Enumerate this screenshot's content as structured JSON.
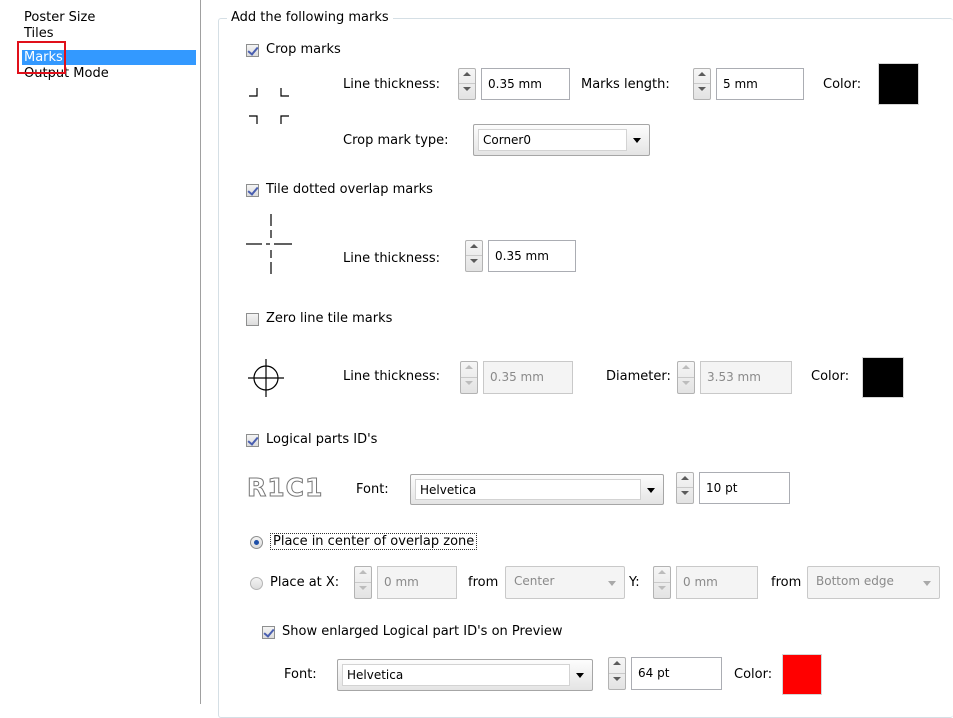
{
  "nav": {
    "items": [
      {
        "label": "Poster Size",
        "selected": false
      },
      {
        "label": "Tiles",
        "selected": false
      },
      {
        "label": "Marks",
        "selected": true
      },
      {
        "label": "Output Mode",
        "selected": false
      }
    ]
  },
  "group_title": "Add the following marks",
  "crop": {
    "label": "Crop marks",
    "checked": true,
    "thickness_label": "Line thickness:",
    "thickness_value": "0.35 mm",
    "length_label": "Marks length:",
    "length_value": "5 mm",
    "color_label": "Color:",
    "color": "#000000",
    "type_label": "Crop mark type:",
    "type_value": "Corner0"
  },
  "dotted": {
    "label": "Tile dotted overlap marks",
    "checked": true,
    "thickness_label": "Line thickness:",
    "thickness_value": "0.35 mm"
  },
  "zero": {
    "label": "Zero line tile marks",
    "checked": false,
    "thickness_label": "Line thickness:",
    "thickness_value": "0.35 mm",
    "diameter_label": "Diameter:",
    "diameter_value": "3.53 mm",
    "color_label": "Color:",
    "color": "#000000"
  },
  "logical": {
    "label": "Logical parts ID's",
    "checked": true,
    "sample": "R1C1",
    "font_label": "Font:",
    "font_value": "Helvetica",
    "size_value": "10 pt"
  },
  "placement": {
    "center_label": "Place in center of overlap zone",
    "center_selected": true,
    "at_label": "Place at X:",
    "x_value": "0 mm",
    "from_label": "from",
    "x_from_value": "Center",
    "y_label": "Y:",
    "y_value": "0 mm",
    "y_from_label": "from",
    "y_from_value": "Bottom edge"
  },
  "enlarged": {
    "label": "Show enlarged Logical part ID's on Preview",
    "checked": true,
    "font_label": "Font:",
    "font_value": "Helvetica",
    "size_value": "64 pt",
    "color_label": "Color:",
    "color": "#ff0000"
  }
}
